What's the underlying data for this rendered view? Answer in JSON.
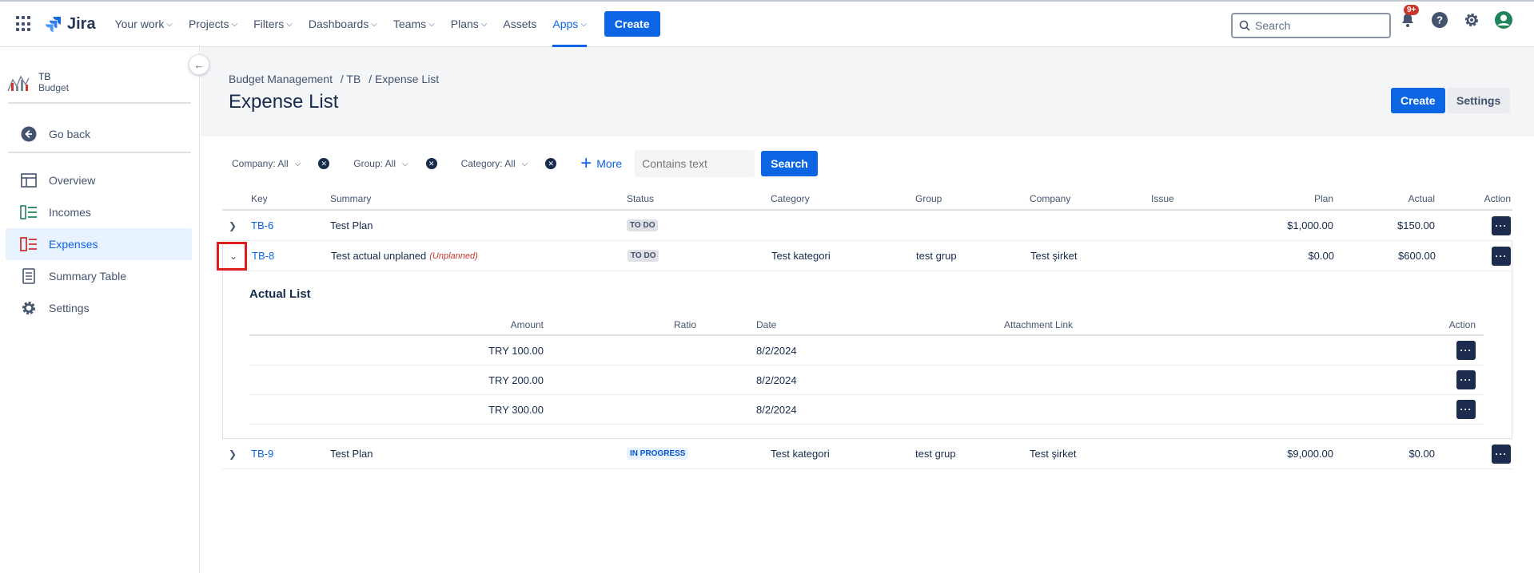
{
  "nav": {
    "logo": "Jira",
    "items": [
      {
        "label": "Your work",
        "dropdown": true
      },
      {
        "label": "Projects",
        "dropdown": true
      },
      {
        "label": "Filters",
        "dropdown": true
      },
      {
        "label": "Dashboards",
        "dropdown": true
      },
      {
        "label": "Teams",
        "dropdown": true
      },
      {
        "label": "Plans",
        "dropdown": true
      },
      {
        "label": "Assets",
        "dropdown": false
      },
      {
        "label": "Apps",
        "dropdown": true,
        "active": true
      }
    ],
    "create_label": "Create",
    "search_placeholder": "Search",
    "notifications_badge": "9+"
  },
  "sidebar": {
    "project_key": "TB",
    "project_name": "Budget",
    "items": [
      {
        "label": "Go back",
        "icon": "arrow-left-circle-icon"
      },
      {
        "label": "Overview",
        "icon": "overview-icon"
      },
      {
        "label": "Incomes",
        "icon": "incomes-icon"
      },
      {
        "label": "Expenses",
        "icon": "expenses-icon",
        "active": true
      },
      {
        "label": "Summary Table",
        "icon": "summary-table-icon"
      },
      {
        "label": "Settings",
        "icon": "gear-icon"
      }
    ]
  },
  "header": {
    "breadcrumb": [
      "Budget Management",
      "/ TB",
      "/ Expense List"
    ],
    "title": "Expense List",
    "create_label": "Create",
    "settings_label": "Settings"
  },
  "filters": {
    "company": "Company: All",
    "group": "Group: All",
    "category": "Category: All",
    "more_label": "More",
    "text_placeholder": "Contains text",
    "search_label": "Search"
  },
  "table": {
    "columns": {
      "key": "Key",
      "summary": "Summary",
      "status": "Status",
      "category": "Category",
      "group": "Group",
      "company": "Company",
      "issue": "Issue",
      "plan": "Plan",
      "actual": "Actual",
      "action": "Action"
    },
    "rows": [
      {
        "key": "TB-6",
        "summary": "Test Plan",
        "unplanned": "",
        "status": "TO DO",
        "category": "",
        "group": "",
        "company": "",
        "issue": "",
        "plan": "$1,000.00",
        "actual": "$150.00"
      },
      {
        "key": "TB-8",
        "summary": "Test actual unplaned",
        "unplanned": "(Unplanned)",
        "status": "TO DO",
        "category": "Test kategori",
        "group": "test grup",
        "company": "Test şirket",
        "issue": "",
        "plan": "$0.00",
        "actual": "$600.00"
      },
      {
        "key": "TB-9",
        "summary": "Test Plan",
        "unplanned": "",
        "status": "IN PROGRESS",
        "category": "Test kategori",
        "group": "test grup",
        "company": "Test şirket",
        "issue": "",
        "plan": "$9,000.00",
        "actual": "$0.00"
      }
    ],
    "actual_list": {
      "title": "Actual List",
      "columns": {
        "amount": "Amount",
        "ratio": "Ratio",
        "date": "Date",
        "attachment": "Attachment Link",
        "action": "Action"
      },
      "rows": [
        {
          "amount": "TRY 100.00",
          "ratio": "",
          "date": "8/2/2024",
          "attachment": ""
        },
        {
          "amount": "TRY 200.00",
          "ratio": "",
          "date": "8/2/2024",
          "attachment": ""
        },
        {
          "amount": "TRY 300.00",
          "ratio": "",
          "date": "8/2/2024",
          "attachment": ""
        }
      ]
    }
  },
  "colors": {
    "brand": "#0c66e4",
    "highlight": "#e01e1e",
    "action_button": "#1d2b4f"
  }
}
